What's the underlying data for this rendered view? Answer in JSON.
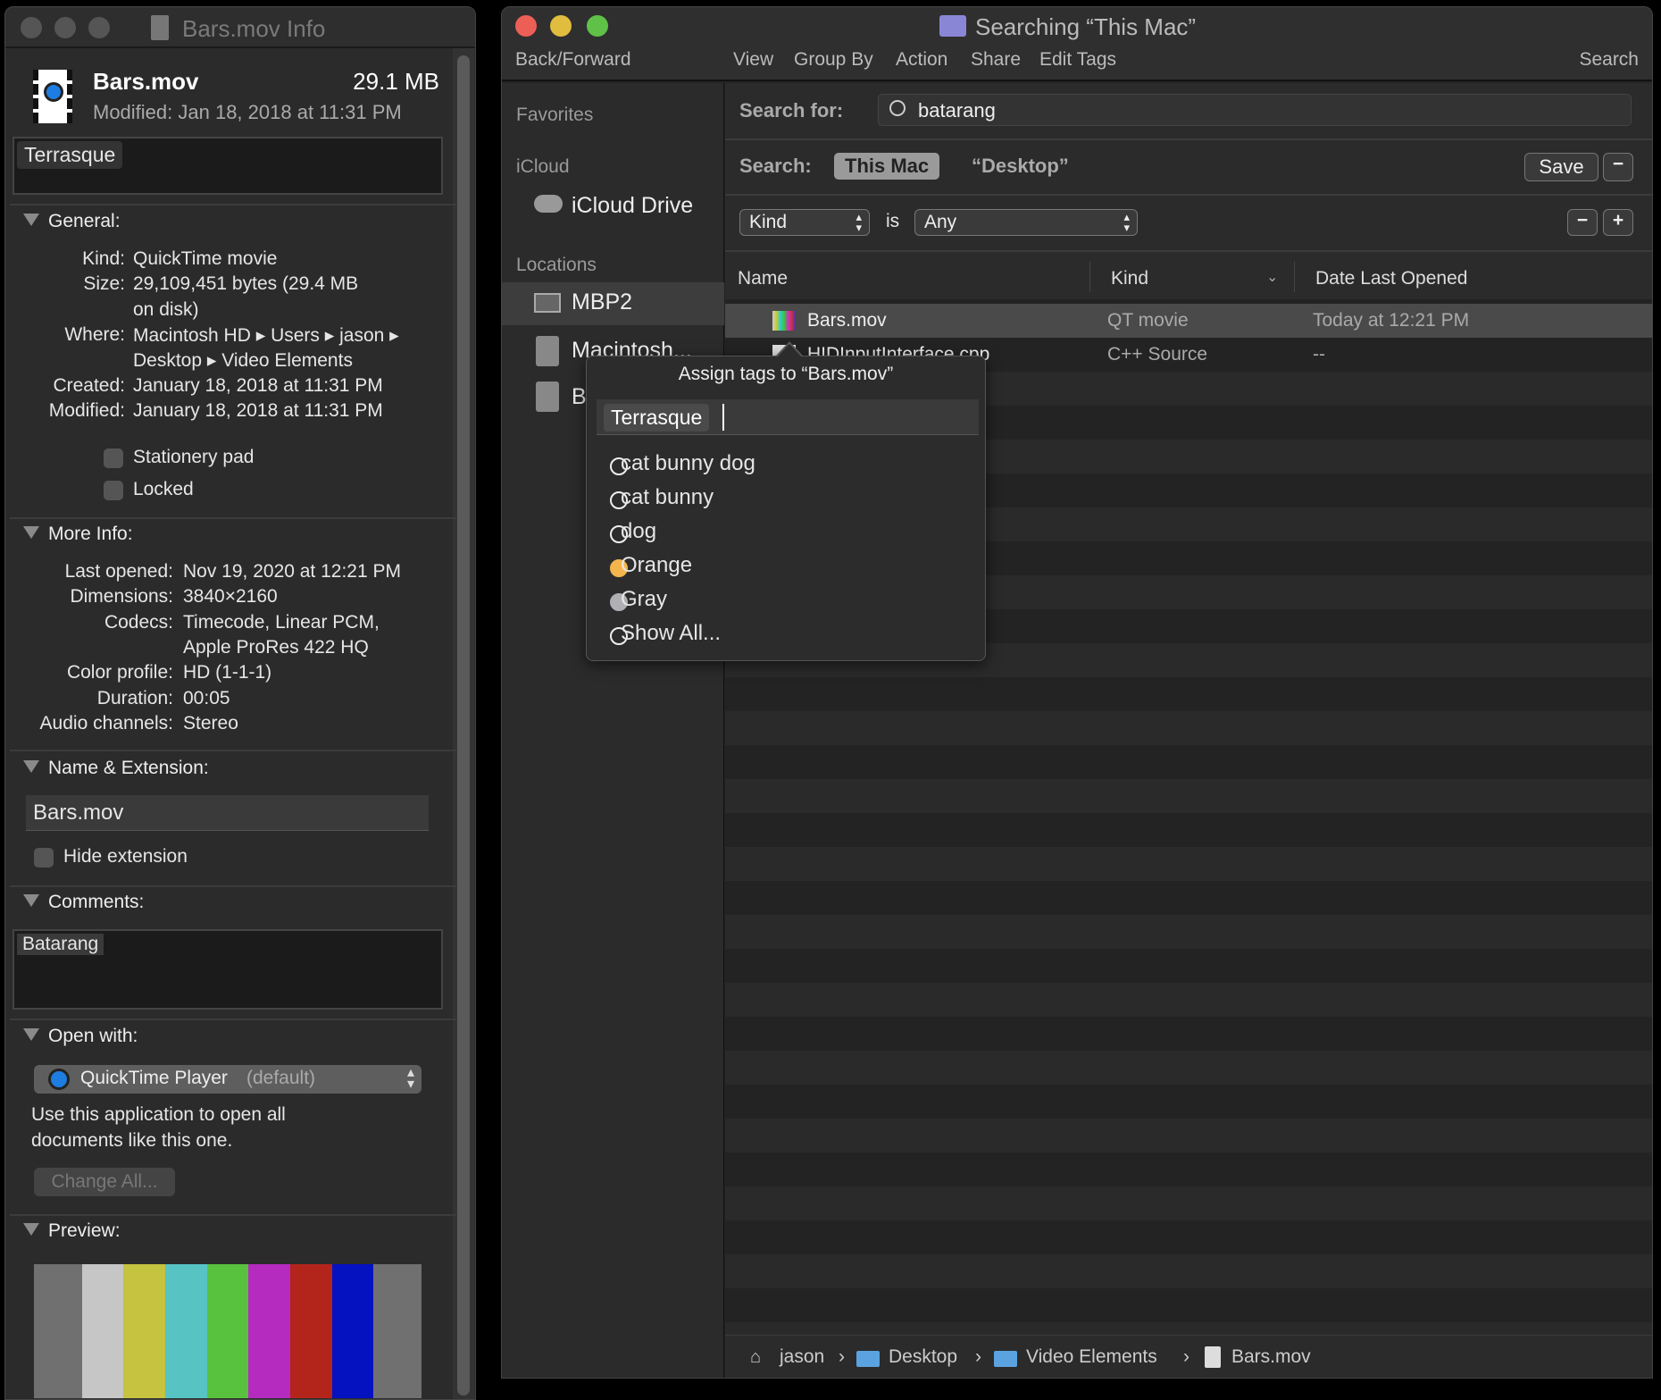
{
  "info_window": {
    "title": "Bars.mov Info",
    "file_name": "Bars.mov",
    "file_size": "29.1 MB",
    "modified": "Modified: Jan 18, 2018 at 11:31 PM",
    "tags": [
      "Terrasque"
    ],
    "general": {
      "header": "General:",
      "rows": [
        {
          "label": "Kind:",
          "value": "QuickTime movie"
        },
        {
          "label": "Size:",
          "value": "29,109,451 bytes (29.4 MB"
        },
        {
          "label": "",
          "value": "on disk)"
        },
        {
          "label": "Where:",
          "value": "Macintosh HD ▸ Users ▸ jason ▸"
        },
        {
          "label": "",
          "value": "Desktop ▸ Video Elements"
        },
        {
          "label": "Created:",
          "value": "January 18, 2018 at 11:31 PM"
        },
        {
          "label": "Modified:",
          "value": "January 18, 2018 at 11:31 PM"
        }
      ],
      "stationery": "Stationery pad",
      "locked": "Locked"
    },
    "more_info": {
      "header": "More Info:",
      "rows": [
        {
          "label": "Last opened:",
          "value": "Nov 19, 2020 at 12:21 PM"
        },
        {
          "label": "Dimensions:",
          "value": "3840×2160"
        },
        {
          "label": "Codecs:",
          "value": "Timecode, Linear PCM,"
        },
        {
          "label": "",
          "value": "Apple ProRes 422 HQ"
        },
        {
          "label": "Color profile:",
          "value": "HD (1-1-1)"
        },
        {
          "label": "Duration:",
          "value": "00:05"
        },
        {
          "label": "Audio channels:",
          "value": "Stereo"
        }
      ]
    },
    "name_ext": {
      "header": "Name & Extension:",
      "value": "Bars.mov",
      "hide": "Hide extension"
    },
    "comments": {
      "header": "Comments:",
      "value": "Batarang"
    },
    "open_with": {
      "header": "Open with:",
      "app": "QuickTime Player",
      "default": "(default)",
      "note1": "Use this application to open all",
      "note2": "documents like this one.",
      "change_all": "Change All..."
    },
    "preview": {
      "header": "Preview:",
      "bar_colors": [
        "#707070",
        "#c6c6c6",
        "#c5c33f",
        "#57c3c3",
        "#58c23e",
        "#b52bbf",
        "#b3241b",
        "#0412c0",
        "#707070"
      ]
    }
  },
  "finder": {
    "title": "Searching “This Mac”",
    "toolbar": {
      "back": "Back/Forward",
      "view": "View",
      "group": "Group By",
      "action": "Action",
      "share": "Share",
      "tags": "Edit Tags",
      "search": "Search"
    },
    "sidebar": {
      "favorites": "Favorites",
      "icloud": "iCloud",
      "icloud_drive": "iCloud Drive",
      "locations": "Locations",
      "items": [
        "MBP2",
        "Macintosh...",
        "B"
      ]
    },
    "search_for_label": "Search for:",
    "query": "batarang",
    "scope_label": "Search:",
    "scope_this_mac": "This Mac",
    "scope_desktop": "“Desktop”",
    "save": "Save",
    "criteria": {
      "attr": "Kind",
      "op": "is",
      "value": "Any"
    },
    "columns": [
      "Name",
      "Kind",
      "Date Last Opened"
    ],
    "rows": [
      {
        "name": "Bars.mov",
        "kind": "QT movie",
        "date": "Today at 12:21 PM"
      },
      {
        "name": "HIDInputInterface.cpp",
        "kind": "C++ Source",
        "date": "--"
      }
    ],
    "path": [
      "jason",
      "Desktop",
      "Video Elements",
      "Bars.mov"
    ],
    "sep": "›"
  },
  "tag_popover": {
    "title": "Assign tags to “Bars.mov”",
    "token": "Terrasque",
    "items": [
      {
        "label": "cat bunny dog",
        "color": ""
      },
      {
        "label": "cat bunny",
        "color": ""
      },
      {
        "label": "dog",
        "color": ""
      },
      {
        "label": "Orange",
        "color": "#f5b54d"
      },
      {
        "label": "Gray",
        "color": "#b0b0b4"
      },
      {
        "label": "Show All...",
        "color": ""
      }
    ]
  }
}
